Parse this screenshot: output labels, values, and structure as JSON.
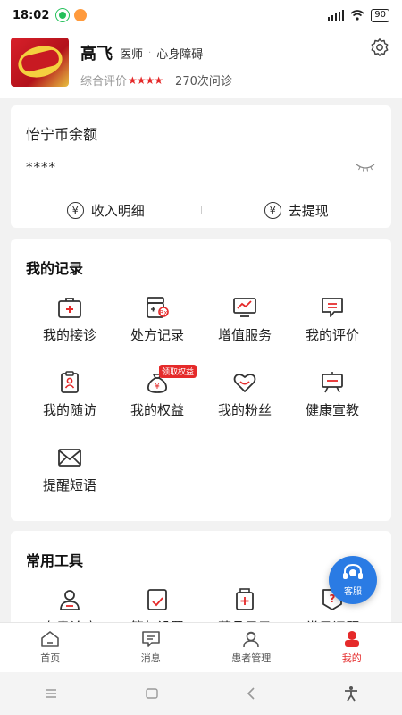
{
  "status_bar": {
    "time": "18:02",
    "battery": "90"
  },
  "profile": {
    "name": "高飞",
    "title": "医师",
    "department": "心身障碍",
    "rating_label": "综合评价",
    "stars": "★★★★",
    "visits": "270次问诊"
  },
  "balance": {
    "label": "怡宁币余额",
    "amount": "****",
    "income_label": "收入明细",
    "withdraw_label": "去提现"
  },
  "records": {
    "title": "我的记录",
    "items": [
      {
        "label": "我的接诊",
        "icon": "medical-kit-icon"
      },
      {
        "label": "处方记录",
        "icon": "prescription-icon"
      },
      {
        "label": "增值服务",
        "icon": "monitor-chart-icon"
      },
      {
        "label": "我的评价",
        "icon": "comment-icon"
      },
      {
        "label": "我的随访",
        "icon": "clipboard-person-icon"
      },
      {
        "label": "我的权益",
        "icon": "money-bag-icon",
        "tag": "领取权益"
      },
      {
        "label": "我的粉丝",
        "icon": "heart-icon"
      },
      {
        "label": "健康宣教",
        "icon": "easel-icon"
      },
      {
        "label": "提醒短语",
        "icon": "envelope-icon"
      }
    ]
  },
  "tools": {
    "title": "常用工具",
    "items": [
      {
        "label": "专患诊疗",
        "icon": "doctor-icon"
      },
      {
        "label": "简复设置",
        "icon": "settings-doc-icon"
      },
      {
        "label": "药品目录",
        "icon": "medicine-bottle-icon"
      },
      {
        "label": "常见问题",
        "icon": "question-badge-icon"
      }
    ]
  },
  "fab": {
    "label": "客服"
  },
  "tabs": [
    {
      "label": "首页",
      "icon": "home-icon"
    },
    {
      "label": "消息",
      "icon": "message-icon"
    },
    {
      "label": "患者管理",
      "icon": "patient-icon"
    },
    {
      "label": "我的",
      "icon": "profile-icon",
      "active": true
    }
  ],
  "colors": {
    "accent": "#e52a2a",
    "fab": "#2a7be4"
  }
}
